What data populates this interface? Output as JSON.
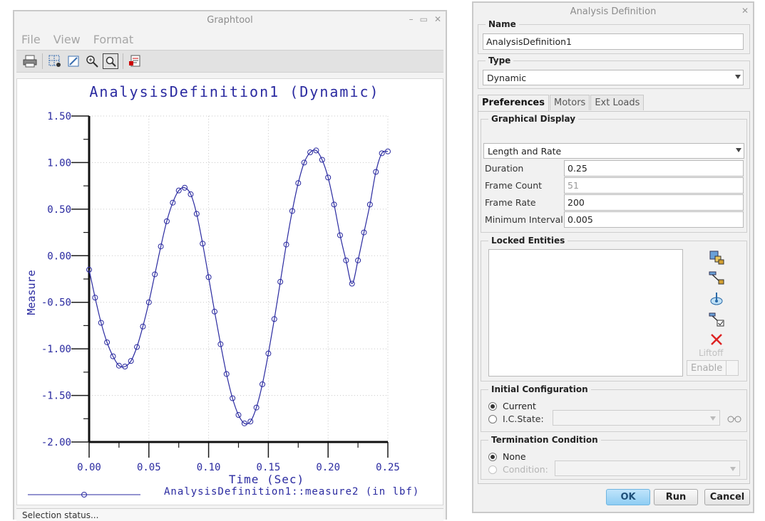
{
  "graphtool": {
    "title": "Graphtool",
    "menu": [
      "File",
      "View",
      "Format"
    ],
    "status": "Selection status..."
  },
  "chart_data": {
    "type": "line",
    "title": "AnalysisDefinition1 (Dynamic)",
    "xlabel": "Time (Sec)",
    "ylabel": "Measure",
    "xlim": [
      0,
      0.25
    ],
    "ylim": [
      -2.0,
      1.5
    ],
    "xticks": [
      "0.00",
      "0.05",
      "0.10",
      "0.15",
      "0.20",
      "0.25"
    ],
    "yticks": [
      "1.50",
      "1.00",
      "0.50",
      "0.00",
      "-0.50",
      "-1.00",
      "-1.50",
      "-2.00"
    ],
    "grid": true,
    "legend": "bottom",
    "series": [
      {
        "name": "AnalysisDefinition1::measure2 (in lbf)",
        "color": "#2a2aa0",
        "marker": "circle",
        "x": [
          0.0,
          0.005,
          0.01,
          0.015,
          0.02,
          0.025,
          0.03,
          0.035,
          0.04,
          0.045,
          0.05,
          0.055,
          0.06,
          0.065,
          0.07,
          0.075,
          0.08,
          0.085,
          0.09,
          0.095,
          0.1,
          0.105,
          0.11,
          0.115,
          0.12,
          0.125,
          0.13,
          0.135,
          0.14,
          0.145,
          0.15,
          0.155,
          0.16,
          0.165,
          0.17,
          0.175,
          0.18,
          0.185,
          0.19,
          0.195,
          0.2,
          0.205,
          0.21,
          0.215,
          0.22,
          0.225,
          0.23,
          0.235,
          0.24,
          0.245,
          0.25
        ],
        "y": [
          -0.15,
          -0.45,
          -0.72,
          -0.93,
          -1.08,
          -1.18,
          -1.19,
          -1.13,
          -0.98,
          -0.76,
          -0.5,
          -0.2,
          0.1,
          0.37,
          0.57,
          0.7,
          0.73,
          0.66,
          0.45,
          0.13,
          -0.23,
          -0.6,
          -0.95,
          -1.27,
          -1.53,
          -1.71,
          -1.8,
          -1.78,
          -1.63,
          -1.38,
          -1.05,
          -0.68,
          -0.28,
          0.12,
          0.48,
          0.78,
          1.0,
          1.11,
          1.13,
          1.03,
          0.84,
          0.55,
          0.22,
          -0.05,
          -0.3,
          -0.05,
          0.25,
          0.55,
          0.9,
          1.1,
          1.12
        ]
      }
    ]
  },
  "analysis": {
    "title": "Analysis Definition",
    "name_label": "Name",
    "name_value": "AnalysisDefinition1",
    "type_label": "Type",
    "type_value": "Dynamic",
    "tabs": [
      "Preferences",
      "Motors",
      "Ext Loads"
    ],
    "graphical_display_label": "Graphical Display",
    "display_mode": "Length and Rate",
    "duration_label": "Duration",
    "duration_value": "0.25",
    "frame_count_label": "Frame Count",
    "frame_count_value": "51",
    "frame_rate_label": "Frame Rate",
    "frame_rate_value": "200",
    "min_interval_label": "Minimum Interval",
    "min_interval_value": "0.005",
    "locked_entities_label": "Locked Entities",
    "liftoff_label": "Liftoff",
    "enable_label": "Enable",
    "initial_config_label": "Initial Configuration",
    "current_label": "Current",
    "ic_state_label": "I.C.State:",
    "termination_label": "Termination Condition",
    "none_label": "None",
    "condition_label": "Condition:",
    "ok_label": "OK",
    "run_label": "Run",
    "cancel_label": "Cancel"
  }
}
